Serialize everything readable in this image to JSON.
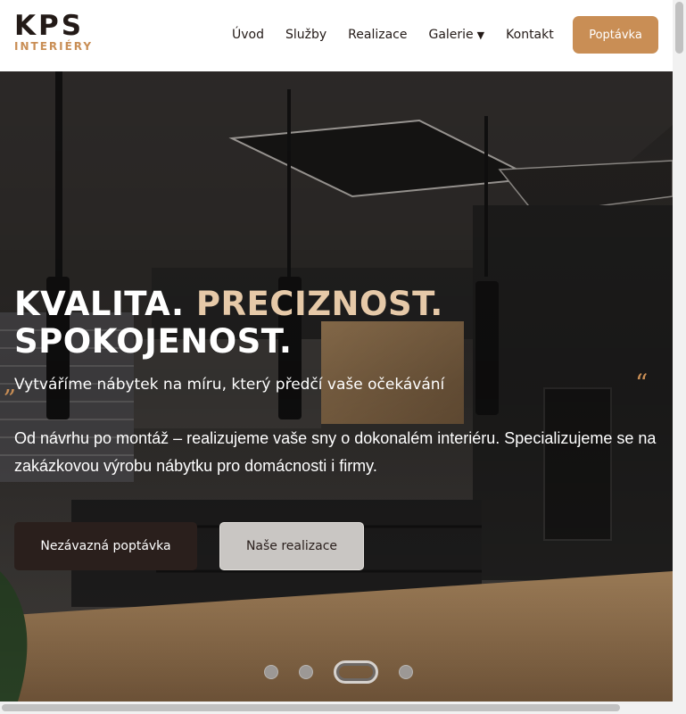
{
  "header": {
    "logo_main": "KPS",
    "logo_sub": "INTERIÉRY",
    "nav": [
      {
        "label": "Úvod"
      },
      {
        "label": "Služby"
      },
      {
        "label": "Realizace"
      },
      {
        "label": "Galerie",
        "caret": "▼"
      },
      {
        "label": "Kontakt"
      }
    ],
    "cta_label": "Poptávka"
  },
  "hero": {
    "title_white": "KVALITA. ",
    "title_accent": "PRECIZNOST.",
    "title_line2": "SPOKOJENOST.",
    "quote_left": "„",
    "quote_right": "“",
    "subtitle": "Vytváříme nábytek na míru, který předčí vaše očekávání",
    "description": "Od návrhu po montáž – realizujeme vaše sny o dokonalém interiéru. Specializujeme se na zakázkovou výrobu nábytku pro domácnosti i firmy.",
    "primary_button": "Nezávazná poptávka",
    "secondary_button": "Naše realizace",
    "slides": {
      "count": 4,
      "active_index": 2
    }
  },
  "colors": {
    "accent": "#c98e55",
    "dark": "#2a1f1c",
    "title_accent": "#e6c9a8"
  }
}
